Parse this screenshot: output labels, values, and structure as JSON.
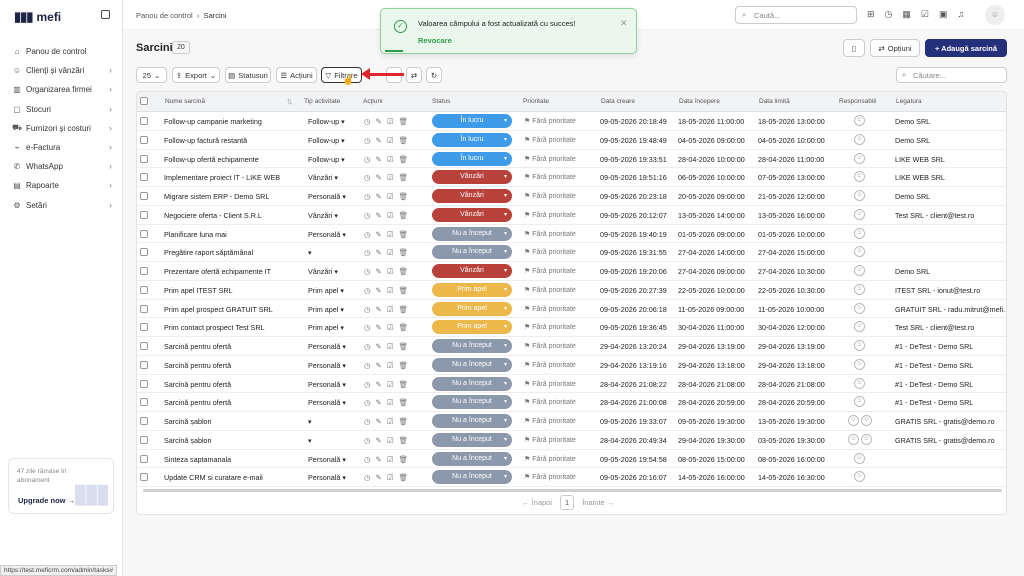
{
  "app": {
    "logo": "mefi"
  },
  "sidebar": {
    "items": [
      {
        "label": "Panou de control",
        "icon": "home-icon",
        "chev": false
      },
      {
        "label": "Clienți și vânzări",
        "icon": "users-icon",
        "chev": true
      },
      {
        "label": "Organizarea firmei",
        "icon": "building-icon",
        "chev": true
      },
      {
        "label": "Stocuri",
        "icon": "box-icon",
        "chev": true
      },
      {
        "label": "Furnizori și costuri",
        "icon": "truck-icon",
        "chev": true
      },
      {
        "label": "e-Factura",
        "icon": "ecommerce-icon",
        "chev": true
      },
      {
        "label": "WhatsApp",
        "icon": "chat-icon",
        "chev": true
      },
      {
        "label": "Rapoarte",
        "icon": "report-icon",
        "chev": true
      },
      {
        "label": "Setări",
        "icon": "gear-icon",
        "chev": true
      }
    ],
    "promo": {
      "text": "47 zile rămase în abonament",
      "cta": "Upgrade now →"
    }
  },
  "breadcrumb": {
    "parent": "Panou de control",
    "current": "Sarcini"
  },
  "top_search": {
    "placeholder": "Caută..."
  },
  "toast": {
    "message": "Valoarea câmpului a fost actualizată cu succes!",
    "undo": "Revocare"
  },
  "page": {
    "title": "Sarcini",
    "count": "20"
  },
  "buttons": {
    "options": "Opțiuni",
    "add_task": "+ Adaugă sarcină",
    "per_page": "25",
    "export": "Export",
    "statuses": "Statusuri",
    "actions": "Acțiuni",
    "filters": "Filtrare"
  },
  "table_search": {
    "placeholder": "Căutare..."
  },
  "columns": [
    "Nume sarcină",
    "Tip activitate",
    "Acțiuni",
    "Status",
    "Prioritate",
    "Data creare",
    "Data începere",
    "Data limită",
    "Responsabili",
    "Legatura"
  ],
  "status_colors": {
    "În lucru": "#3d9be9",
    "Vânzări": "#b8423a",
    "Nu a început": "#8c98ac",
    "Prim apel": "#ecb84a"
  },
  "rows": [
    {
      "name": "Follow-up campanie marketing",
      "type": "Follow-up",
      "status": "În lucru",
      "prio": "Fără prioritate",
      "created": "09-05-2026 20:18:49",
      "start": "18-05-2026 11:00:00",
      "due": "18-05-2026 13:00:00",
      "resp": 1,
      "link": "Demo SRL"
    },
    {
      "name": "Follow-up factură restantă",
      "type": "Follow-up",
      "status": "În lucru",
      "prio": "Fără prioritate",
      "created": "09-05-2026 19:48:49",
      "start": "04-05-2026 09:00:00",
      "due": "04-05-2026 10:00:00",
      "resp": 1,
      "link": "Demo SRL"
    },
    {
      "name": "Follow-up ofertă echipamente",
      "type": "Follow-up",
      "status": "În lucru",
      "prio": "Fără prioritate",
      "created": "09-05-2026 19:33:51",
      "start": "28-04-2026 10:00:00",
      "due": "28-04-2026 11:00:00",
      "resp": 1,
      "link": "LIKE WEB SRL"
    },
    {
      "name": "Implementare proiect IT - LIKE WEB",
      "type": "Vânzări",
      "status": "Vânzări",
      "prio": "Fără prioritate",
      "created": "09-05-2026 19:51:16",
      "start": "06-05-2026 10:00:00",
      "due": "07-05-2026 13:00:00",
      "resp": 1,
      "link": "LIKE WEB SRL"
    },
    {
      "name": "Migrare sistem ERP - Demo SRL",
      "type": "Personală",
      "status": "Vânzări",
      "prio": "Fără prioritate",
      "created": "09-05-2026 20:23:18",
      "start": "20-05-2026 09:00:00",
      "due": "21-05-2026 12:00:00",
      "resp": 1,
      "link": "Demo SRL"
    },
    {
      "name": "Negociere oferta - Client S.R.L",
      "type": "Vânzări",
      "status": "Vânzări",
      "prio": "Fără prioritate",
      "created": "09-05-2026 20:12:07",
      "start": "13-05-2026 14:00:00",
      "due": "13-05-2026 16:00:00",
      "resp": 1,
      "link": "Test SRL - client@test.ro"
    },
    {
      "name": "Planificare luna mai",
      "type": "Personală",
      "status": "Nu a început",
      "prio": "Fără prioritate",
      "created": "09-05-2026 19:40:19",
      "start": "01-05-2026 09:00:00",
      "due": "01-05-2026 10:00:00",
      "resp": 1,
      "link": ""
    },
    {
      "name": "Pregătire raport săptămânal",
      "type": "",
      "status": "Nu a început",
      "prio": "Fără prioritate",
      "created": "09-05-2026 19:31:55",
      "start": "27-04-2026 14:00:00",
      "due": "27-04-2026 15:00:00",
      "resp": 1,
      "link": ""
    },
    {
      "name": "Prezentare ofertă echipamente IT",
      "type": "Vânzări",
      "status": "Vânzări",
      "prio": "Fără prioritate",
      "created": "09-05-2026 19:20:06",
      "start": "27-04-2026 09:00:00",
      "due": "27-04-2026 10:30:00",
      "resp": 1,
      "link": "Demo SRL"
    },
    {
      "name": "Prim apel ITEST SRL",
      "type": "Prim apel",
      "status": "Prim apel",
      "prio": "Fără prioritate",
      "created": "09-05-2026 20:27:39",
      "start": "22-05-2026 10:00:00",
      "due": "22-05-2026 10:30:00",
      "resp": 1,
      "link": "ITEST SRL - ionut@test.ro"
    },
    {
      "name": "Prim apel prospect GRATUIT SRL",
      "type": "Prim apel",
      "status": "Prim apel",
      "prio": "Fără prioritate",
      "created": "09-05-2026 20:06:18",
      "start": "11-05-2026 09:00:00",
      "due": "11-05-2026 10:00:00",
      "resp": 1,
      "link": "GRATUIT SRL - radu.mitrut@mefi.ro"
    },
    {
      "name": "Prim contact prospect Test SRL",
      "type": "Prim apel",
      "status": "Prim apel",
      "prio": "Fără prioritate",
      "created": "09-05-2026 19:36:45",
      "start": "30-04-2026 11:00:00",
      "due": "30-04-2026 12:00:00",
      "resp": 1,
      "link": "Test SRL - client@test.ro"
    },
    {
      "name": "Sarcină pentru ofertă",
      "type": "Personală",
      "status": "Nu a început",
      "prio": "Fără prioritate",
      "created": "29-04-2026 13:20:24",
      "start": "29-04-2026 13:19:00",
      "due": "29-04-2026 13:19:00",
      "resp": 1,
      "link": "#1 - DeTest - Demo SRL"
    },
    {
      "name": "Sarcină pentru ofertă",
      "type": "Personală",
      "status": "Nu a început",
      "prio": "Fără prioritate",
      "created": "29-04-2026 13:19:16",
      "start": "29-04-2026 13:18:00",
      "due": "29-04-2026 13:18:00",
      "resp": 1,
      "link": "#1 - DeTest - Demo SRL"
    },
    {
      "name": "Sarcină pentru ofertă",
      "type": "Personală",
      "status": "Nu a început",
      "prio": "Fără prioritate",
      "created": "28-04-2026 21:08:22",
      "start": "28-04-2026 21:08:00",
      "due": "28-04-2026 21:08:00",
      "resp": 1,
      "link": "#1 - DeTest - Demo SRL"
    },
    {
      "name": "Sarcină pentru ofertă",
      "type": "Personală",
      "status": "Nu a început",
      "prio": "Fără prioritate",
      "created": "28-04-2026 21:00:08",
      "start": "28-04-2026 20:59:00",
      "due": "28-04-2026 20:59:00",
      "resp": 1,
      "link": "#1 - DeTest - Demo SRL"
    },
    {
      "name": "Sarcină șablon",
      "type": "",
      "status": "Nu a început",
      "prio": "Fără prioritate",
      "created": "09-05-2026 19:33:07",
      "start": "09-05-2026 19:30:00",
      "due": "13-05-2026 19:30:00",
      "resp": 2,
      "link": "GRATIS SRL - gratis@demo.ro"
    },
    {
      "name": "Sarcină șablon",
      "type": "",
      "status": "Nu a început",
      "prio": "Fără prioritate",
      "created": "28-04-2026 20:49:34",
      "start": "29-04-2026 19:30:00",
      "due": "03-05-2026 19:30:00",
      "resp": 2,
      "link": "GRATIS SRL - gratis@demo.ro"
    },
    {
      "name": "Sinteza saptamanala",
      "type": "Personală",
      "status": "Nu a început",
      "prio": "Fără prioritate",
      "created": "09-05-2026 19:54:58",
      "start": "08-05-2026 15:00:00",
      "due": "08-05-2026 16:00:00",
      "resp": 1,
      "link": ""
    },
    {
      "name": "Update CRM si curatare e-mail",
      "type": "Personală",
      "status": "Nu a început",
      "prio": "Fără prioritate",
      "created": "09-05-2026 20:16:07",
      "start": "14-05-2026 16:00:00",
      "due": "14-05-2026 16:30:00",
      "resp": 1,
      "link": ""
    }
  ],
  "pagination": {
    "prev": "← Înapoi",
    "page": "1",
    "next": "Înainte →"
  },
  "status_url": "https://test.meficrm.com/admin/tasks#"
}
